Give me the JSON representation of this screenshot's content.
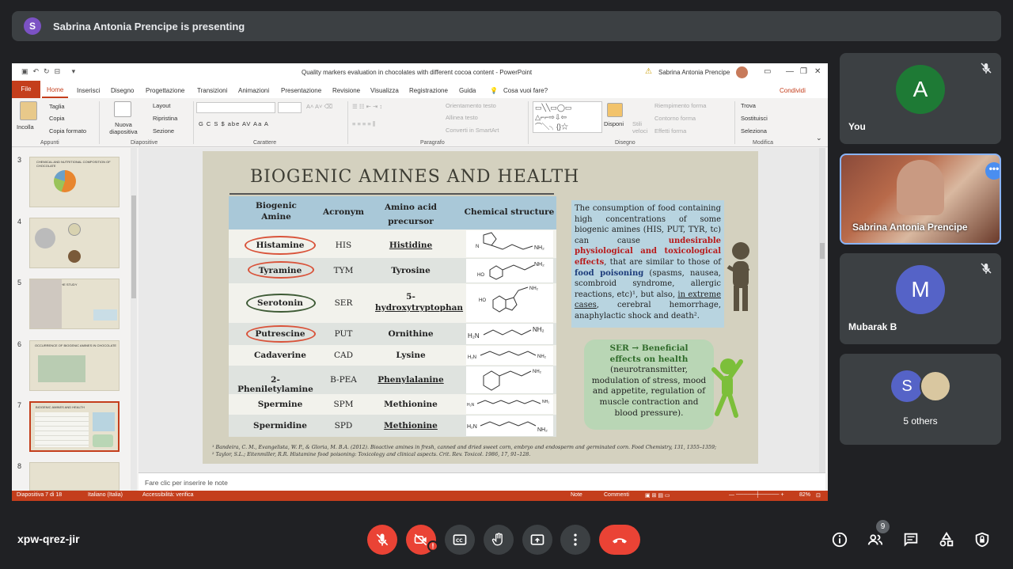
{
  "presenting": {
    "avatar_letter": "S",
    "text": "Sabrina Antonia Prencipe is presenting"
  },
  "ppt": {
    "window_title": "Quality markers evaluation in chocolates with different cocoa content  -  PowerPoint",
    "user": "Sabrina Antonia Prencipe",
    "menu": {
      "file": "File",
      "home": "Home",
      "tabs": [
        "Inserisci",
        "Disegno",
        "Progettazione",
        "Transizioni",
        "Animazioni",
        "Presentazione",
        "Revisione",
        "Visualizza",
        "Registrazione",
        "Guida"
      ],
      "search": "Cosa vuoi fare?",
      "share": "Condividi"
    },
    "ribbon": {
      "paste": "Incolla",
      "cut": "Taglia",
      "copy": "Copia",
      "format": "Copia formato",
      "new_slide": "Nuova diapositiva",
      "layout": "Layout",
      "reset": "Ripristina",
      "section": "Sezione",
      "align_text": "Orientamento testo",
      "align_obj": "Allinea testo",
      "smartart": "Converti in SmartArt",
      "arrange": "Disponi",
      "styles": "Stili veloci",
      "fill": "Riempimento forma",
      "outline": "Contorno forma",
      "effects": "Effetti forma",
      "find": "Trova",
      "replace": "Sostituisci",
      "select": "Seleziona",
      "groups": {
        "clipboard": "Appunti",
        "slides": "Diapositive",
        "font": "Carattere",
        "paragraph": "Paragrafo",
        "drawing": "Disegno",
        "editing": "Modifica"
      },
      "font_buttons": "G  C  S  $  abe  AV  Aa  A"
    },
    "thumbs": [
      {
        "num": "3",
        "title": "CHEMICAL AND NUTRITIONAL COMPOSITION OF CHOCOLATE"
      },
      {
        "num": "4",
        "title": ""
      },
      {
        "num": "5",
        "title": "AIM OF THE STUDY"
      },
      {
        "num": "6",
        "title": "OCCURRENCE OF BIOGENIC AMINES IN CHOCOLATE"
      },
      {
        "num": "7",
        "title": "BIOGENIC AMINES AND HEALTH"
      },
      {
        "num": "8",
        "title": ""
      }
    ],
    "notes_placeholder": "Fare clic per inserire le note",
    "status": {
      "slide": "Diapositiva 7 di 18",
      "lang": "Italiano (Italia)",
      "access": "Accessibilità: verifica",
      "notes": "Note",
      "comments": "Commenti",
      "zoom": "82%"
    }
  },
  "slide": {
    "title": "BIOGENIC AMINES AND HEALTH",
    "headers": {
      "amine": [
        "Biogenic",
        "Amine"
      ],
      "acronym": "Acronym",
      "precursor": [
        "Amino acid",
        "precursor"
      ],
      "structure": "Chemical structure"
    },
    "rows": [
      {
        "amine": "Histamine",
        "acronym": "HIS",
        "precursor": "Histidine"
      },
      {
        "amine": "Tyramine",
        "acronym": "TYM",
        "precursor": "Tyrosine"
      },
      {
        "amine": "Serotonin",
        "acronym": "SER",
        "precursor": "5-",
        "precursor2": "hydroxytryptophan"
      },
      {
        "amine": "Putrescine",
        "acronym": "PUT",
        "precursor": "Ornithine"
      },
      {
        "amine": "Cadaverine",
        "acronym": "CAD",
        "precursor": "Lysine"
      },
      {
        "amine": "2- Pheniletylamine",
        "acronym": "B-PEA",
        "precursor": "Phenylalanine"
      },
      {
        "amine": "Spermine",
        "acronym": "SPM",
        "precursor": "Methionine"
      },
      {
        "amine": "Spermidine",
        "acronym": "SPD",
        "precursor": "Methionine"
      }
    ],
    "info": {
      "p1": "The consumption of food containing high concentrations of some biogenic amines (HIS, PUT, TYR, tc) can cause ",
      "red": "undesirable physiological and toxicological effects",
      "p2": ", that are similar to those of ",
      "blue": "food poisoning",
      "p3": " (spasms, nausea, scombroid syndrome, allergic reactions, etc)¹, but also, ",
      "u": "in extreme cases",
      "p4": ", cerebral hemorrhage, anaphylactic shock and death²."
    },
    "ser_box": {
      "title": "SER → Beneficial effects on health",
      "body": "(neurotransmitter, modulation of stress, mood and appetite, regulation of muscle contraction and blood pressure)."
    },
    "ref1": "¹ Bandeira, C. M., Evangelista, W. P., & Gloria, M. B.A. (2012). Bioactive amines in fresh, canned and dried sweet corn, embryo and endosperm and germinated corn. Food Chemistry, 131, 1355–1359;",
    "ref2": "² Taylor, S.L.; Eitenmiller, R.R. Histamine food poisoning: Toxicology and clinical aspects. Crit. Rev. Toxicol. 1986, 17, 91–128."
  },
  "participants": {
    "you": {
      "letter": "A",
      "name": "You"
    },
    "sabrina": {
      "name": "Sabrina Antonia Prencipe"
    },
    "mubarak": {
      "letter": "M",
      "name": "Mubarak B"
    },
    "others": {
      "letter": "S",
      "name": "5 others"
    }
  },
  "meeting_code": "xpw-qrez-jir",
  "people_count": "9",
  "colors": {
    "accent_red": "#ea4335",
    "ppt_orange": "#c43e1c"
  }
}
